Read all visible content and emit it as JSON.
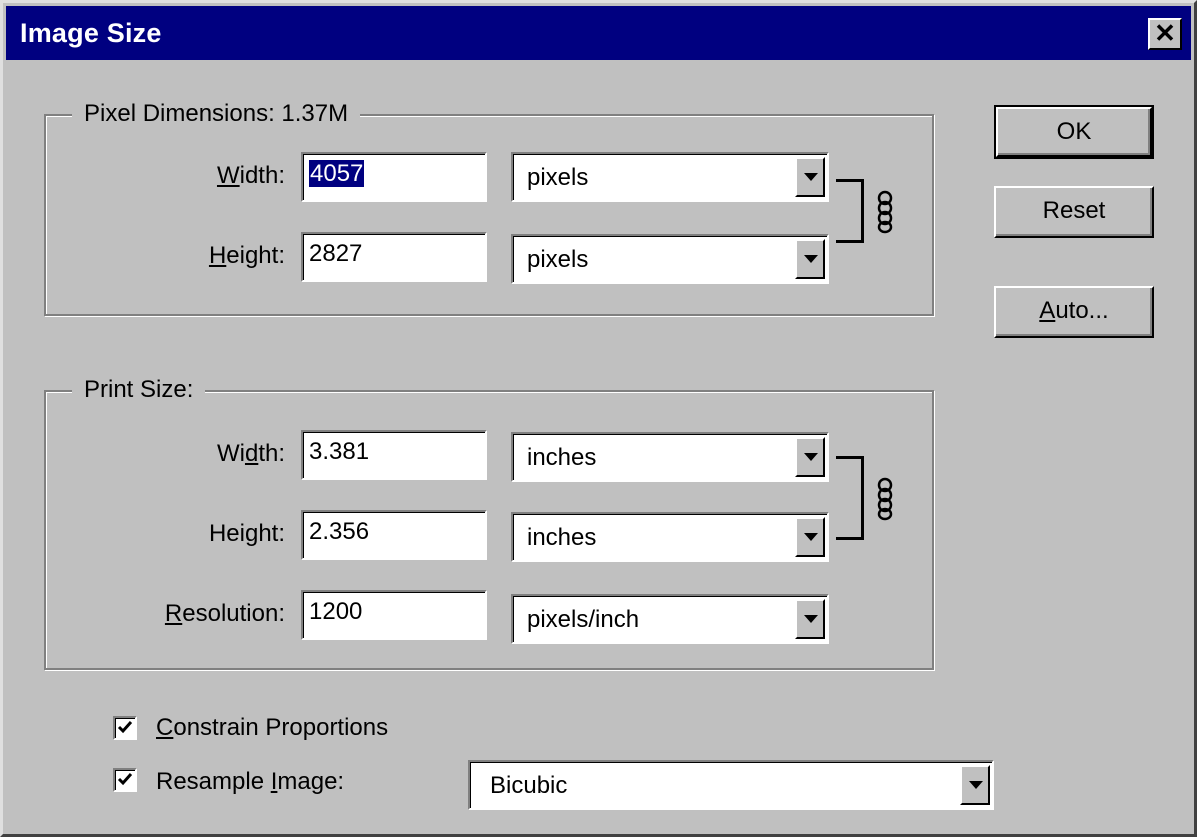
{
  "window": {
    "title": "Image Size",
    "close_glyph": "✕"
  },
  "pixel_dimensions": {
    "title": "Pixel Dimensions:  1.37M",
    "width": {
      "label_pre": "",
      "label_u": "W",
      "label_post": "idth:",
      "value": "4057",
      "unit": "pixels"
    },
    "height": {
      "label_pre": "",
      "label_u": "H",
      "label_post": "eight:",
      "value": "2827",
      "unit": "pixels"
    }
  },
  "print_size": {
    "title": "Print Size:",
    "width": {
      "label_pre": "Wi",
      "label_u": "d",
      "label_post": "th:",
      "value": "3.381",
      "unit": "inches"
    },
    "height": {
      "label_pre": "Hei",
      "label_u": "g",
      "label_post": "ht:",
      "value": "2.356",
      "unit": "inches"
    },
    "resolution": {
      "label_pre": "",
      "label_u": "R",
      "label_post": "esolution:",
      "value": "1200",
      "unit": "pixels/inch"
    }
  },
  "buttons": {
    "ok": "OK",
    "reset": "Reset",
    "auto_u": "A",
    "auto_rest": "uto..."
  },
  "options": {
    "constrain": {
      "label_u": "C",
      "label_rest": "onstrain Proportions",
      "checked": true
    },
    "resample": {
      "label_pre": "Resample ",
      "label_u": "I",
      "label_post": "mage:",
      "checked": true,
      "method": "Bicubic"
    }
  },
  "icons": {
    "link": "chain-link-icon",
    "dropdown": "chevron-down-icon",
    "check": "checkmark-icon",
    "close": "close-icon"
  },
  "colors": {
    "titlebar": "#000080",
    "face": "#c0c0c0",
    "selection": "#000080"
  }
}
